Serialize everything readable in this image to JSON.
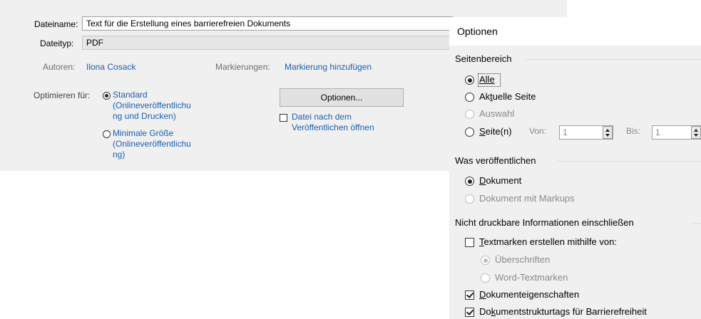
{
  "save_panel": {
    "filename_label": "Dateiname:",
    "filename_value": "Text für die Erstellung eines barrierefreien Dokuments",
    "filetype_label": "Dateityp:",
    "filetype_value": "PDF",
    "authors_label": "Autoren:",
    "authors_value": "Ilona Cosack",
    "tags_label": "Markierungen:",
    "tags_value": "Markierung hinzufügen",
    "optimize_label": "Optimieren für:",
    "optimize_options": [
      {
        "lines": [
          "Standard",
          "(Onlineveröffentlichu",
          "ng und Drucken)"
        ],
        "selected": true
      },
      {
        "lines": [
          "Minimale Größe",
          "(Onlineveröffentlichu",
          "ng)"
        ],
        "selected": false
      }
    ],
    "options_button": "Optionen...",
    "open_after_publish_lines": [
      "Datei nach dem",
      "Veröffentlichen öffnen"
    ],
    "open_after_publish_checked": false
  },
  "options_dialog": {
    "title": "Optionen",
    "page_range": {
      "title": "Seitenbereich",
      "all": {
        "pre": "",
        "ul": "Alle",
        "post": "",
        "selected": true
      },
      "current": {
        "pre": "Ak",
        "ul": "t",
        "post": "uelle Seite",
        "selected": false
      },
      "selection": {
        "label": "Auswahl",
        "enabled": false
      },
      "pages": {
        "pre": "",
        "ul": "S",
        "post": "eite(n)",
        "selected": false
      },
      "from_label": "Von:",
      "from_value": "1",
      "to_label": "Bis:",
      "to_value": "1"
    },
    "publish_what": {
      "title": "Was veröffentlichen",
      "document": {
        "pre": "",
        "ul": "D",
        "post": "okument",
        "selected": true
      },
      "with_markups": {
        "label": "Dokument mit Markups",
        "enabled": false
      }
    },
    "non_printing": {
      "title": "Nicht druckbare Informationen einschließen",
      "bookmarks": {
        "pre": "",
        "ul": "T",
        "post": "extmarken erstellen mithilfe von:",
        "checked": false
      },
      "headings": {
        "label": "Überschriften",
        "enabled": false,
        "selected": true
      },
      "word_bookmarks": {
        "label": "Word-Textmarken",
        "enabled": false,
        "selected": false
      },
      "doc_properties": {
        "pre": "",
        "ul": "D",
        "post": "okumenteigenschaften",
        "checked": true
      },
      "structure_tags": {
        "pre": "Do",
        "ul": "k",
        "post": "umentstrukturtags für Barrierefreiheit",
        "checked": true
      }
    }
  }
}
